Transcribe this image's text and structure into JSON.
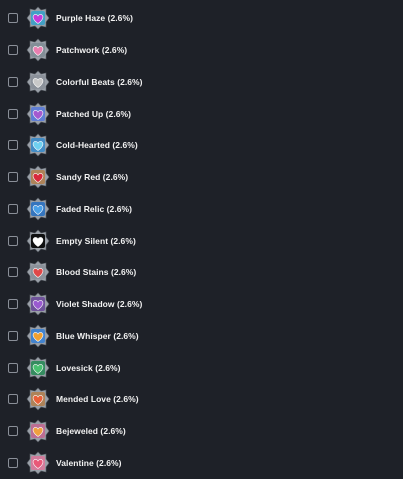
{
  "items": [
    {
      "label": "Purple Haze (2.6%)",
      "icon": "purple-heart-badge-icon",
      "color": "#c43ad8",
      "frame": "#3aa0c8"
    },
    {
      "label": "Patchwork (2.6%)",
      "icon": "patchwork-heart-badge-icon",
      "color": "#e87fb0",
      "frame": "#7f8c95"
    },
    {
      "label": "Colorful Beats (2.6%)",
      "icon": "colorful-heart-badge-icon",
      "color": "#c8c8c8",
      "frame": "#8a8f98"
    },
    {
      "label": "Patched Up (2.6%)",
      "icon": "patched-heart-badge-icon",
      "color": "#a45ad0",
      "frame": "#5a7ad8"
    },
    {
      "label": "Cold-Hearted (2.6%)",
      "icon": "cold-heart-badge-icon",
      "color": "#6fd0f0",
      "frame": "#3a8ac8"
    },
    {
      "label": "Sandy Red (2.6%)",
      "icon": "red-heart-badge-icon",
      "color": "#d8283a",
      "frame": "#b08050"
    },
    {
      "label": "Faded Relic (2.6%)",
      "icon": "relic-heart-badge-icon",
      "color": "#4aa0e8",
      "frame": "#2a70c0"
    },
    {
      "label": "Empty Silent (2.6%)",
      "icon": "empty-heart-badge-icon",
      "color": "#ffffff",
      "frame": "#000000"
    },
    {
      "label": "Blood Stains (2.6%)",
      "icon": "blood-heart-badge-icon",
      "color": "#e04848",
      "frame": "#8a8f98"
    },
    {
      "label": "Violet Shadow (2.6%)",
      "icon": "violet-heart-badge-icon",
      "color": "#9a5ad0",
      "frame": "#6a4a98"
    },
    {
      "label": "Blue Whisper (2.6%)",
      "icon": "blue-heart-badge-icon",
      "color": "#f0a030",
      "frame": "#3a80d0"
    },
    {
      "label": "Lovesick (2.6%)",
      "icon": "green-heart-badge-icon",
      "color": "#48c070",
      "frame": "#2a8a58"
    },
    {
      "label": "Mended Love (2.6%)",
      "icon": "mended-heart-badge-icon",
      "color": "#e86038",
      "frame": "#b08050"
    },
    {
      "label": "Bejeweled (2.6%)",
      "icon": "jewel-heart-badge-icon",
      "color": "#f0a040",
      "frame": "#c06890"
    },
    {
      "label": "Valentine (2.6%)",
      "icon": "valentine-heart-badge-icon",
      "color": "#e85878",
      "frame": "#d8789a"
    }
  ]
}
